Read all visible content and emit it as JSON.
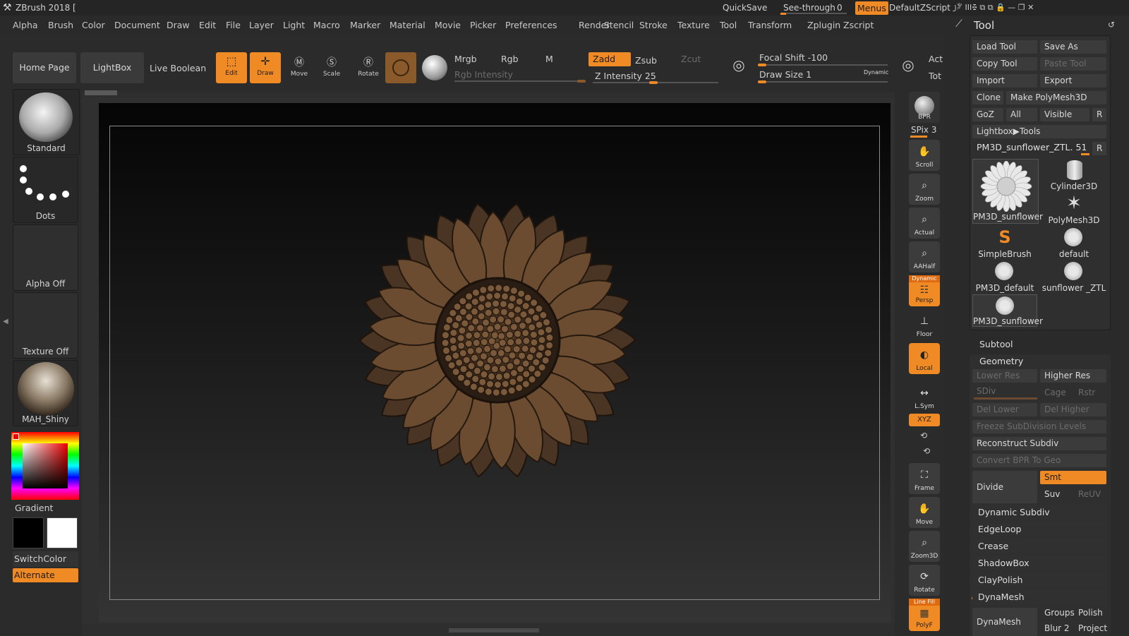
{
  "titlebar": {
    "app_title": "ZBrush 2018 [",
    "quicksave": "QuickSave",
    "seethrough_label": "See-through",
    "seethrough_value": "0",
    "menus": "Menus",
    "script": "DefaultZScript"
  },
  "menubar": [
    "Alpha",
    "Brush",
    "Color",
    "Document",
    "Draw",
    "Edit",
    "File",
    "Layer",
    "Light",
    "Macro",
    "Marker",
    "Material",
    "Movie",
    "Picker",
    "Preferences",
    "Render",
    "Stencil",
    "Stroke",
    "Texture",
    "Tool",
    "Transform",
    "Zplugin",
    "Zscript"
  ],
  "shelf": {
    "home": "Home Page",
    "lightbox": "LightBox",
    "live_boolean": "Live Boolean",
    "edit": "Edit",
    "draw": "Draw",
    "move": "Move",
    "scale": "Scale",
    "rotate": "Rotate",
    "mrgb": "Mrgb",
    "rgb": "Rgb",
    "m": "M",
    "rgb_intensity": "Rgb Intensity",
    "zadd": "Zadd",
    "zsub": "Zsub",
    "zcut": "Zcut",
    "z_intensity": "Z Intensity 25",
    "focal_shift": "Focal Shift -100",
    "draw_size": "Draw Size 1",
    "dynamic": "Dynamic",
    "act": "Act",
    "tot": "Tot",
    "focal_value": -100,
    "draw_size_value": 1,
    "z_intensity_value": 25
  },
  "left": {
    "brush": "Standard",
    "stroke": "Dots",
    "alpha": "Alpha Off",
    "texture": "Texture Off",
    "material": "MAH_Shiny",
    "gradient": "Gradient",
    "switch": "SwitchColor",
    "alternate": "Alternate"
  },
  "right_tools": {
    "bpr": "BPR",
    "spix": "SPix 3",
    "scroll": "Scroll",
    "zoom": "Zoom",
    "actual": "Actual",
    "aahalf": "AAHalf",
    "dynamic": "Dynamic",
    "persp": "Persp",
    "floor": "Floor",
    "local": "Local",
    "lsym": "L.Sym",
    "xyz": "XYZ",
    "frame": "Frame",
    "move": "Move",
    "zoom3d": "Zoom3D",
    "rotate": "Rotate",
    "linefill": "Line Fill",
    "polyf": "PolyF"
  },
  "tool_panel": {
    "title": "Tool",
    "load": "Load Tool",
    "saveas": "Save As",
    "copy": "Copy Tool",
    "paste": "Paste Tool",
    "import": "Import",
    "export": "Export",
    "clone": "Clone",
    "make_poly": "Make PolyMesh3D",
    "goz": "GoZ",
    "all": "All",
    "visible": "Visible",
    "r": "R",
    "lightbox_tools": "Lightbox▶Tools",
    "current": "PM3D_sunflower_ZTL. 51",
    "thumbs": [
      "PM3D_sunflower",
      "Cylinder3D",
      "PolyMesh3D",
      "SimpleBrush",
      "default",
      "PM3D_default",
      "sunflower _ZTL",
      "PM3D_sunflower"
    ],
    "subtool": "Subtool",
    "geometry": "Geometry",
    "lower_res": "Lower Res",
    "higher_res": "Higher Res",
    "sdiv": "SDiv",
    "cage": "Cage",
    "rstr": "Rstr",
    "del_lower": "Del Lower",
    "del_higher": "Del Higher",
    "freeze": "Freeze SubDivision Levels",
    "reconstruct": "Reconstruct Subdiv",
    "convert": "Convert BPR To Geo",
    "divide": "Divide",
    "smt": "Smt",
    "suv": "Suv",
    "reuv": "ReUV",
    "sections": [
      "Dynamic Subdiv",
      "EdgeLoop",
      "Crease",
      "ShadowBox",
      "ClayPolish",
      "DynaMesh"
    ],
    "dyn_label": "DynaMesh",
    "groups": "Groups",
    "polish": "Polish",
    "blur": "Blur 2",
    "project": "Project"
  },
  "colors": {
    "accent": "#f08a24",
    "bg": "#2e2e2e"
  }
}
